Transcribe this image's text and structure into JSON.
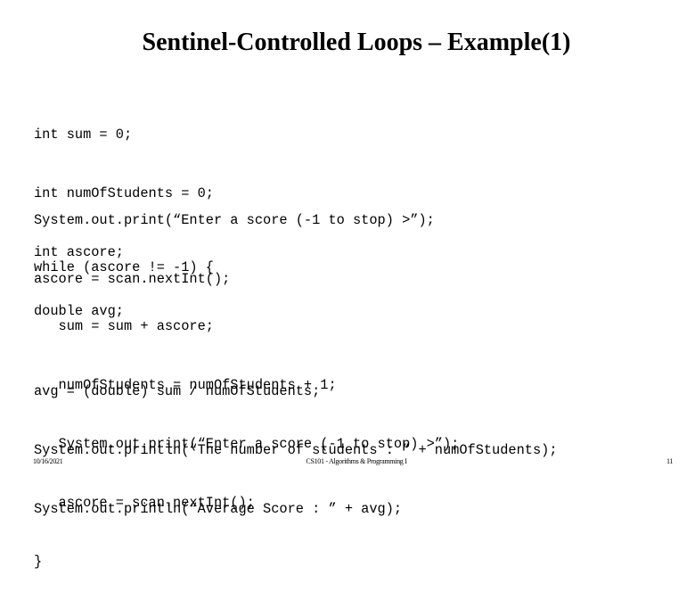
{
  "slide": {
    "title": "Sentinel-Controlled Loops – Example(1)",
    "code_blocks": [
      [
        "int sum = 0;",
        "int numOfStudents = 0;",
        "int ascore;",
        "double avg;"
      ],
      [
        "System.out.print(“Enter a score (-1 to stop) >”);",
        "ascore = scan.nextInt();"
      ],
      [
        "while (ascore != -1) {",
        "   sum = sum + ascore;",
        "   numOfStudents = numOfStudents + 1;",
        "   System.out.print(“Enter a score (-1 to stop) >”);",
        "   ascore = scan.nextInt();",
        "}"
      ],
      [
        "avg = (double) sum / numOfStudents;",
        "System.out.println(“The number of students : ” + numOfStudents);",
        "System.out.println(“Average Score : ” + avg);"
      ]
    ]
  },
  "footer": {
    "date": "10/16/2021",
    "course": "CS101 - Algorithms & Programming I",
    "page": "11"
  }
}
